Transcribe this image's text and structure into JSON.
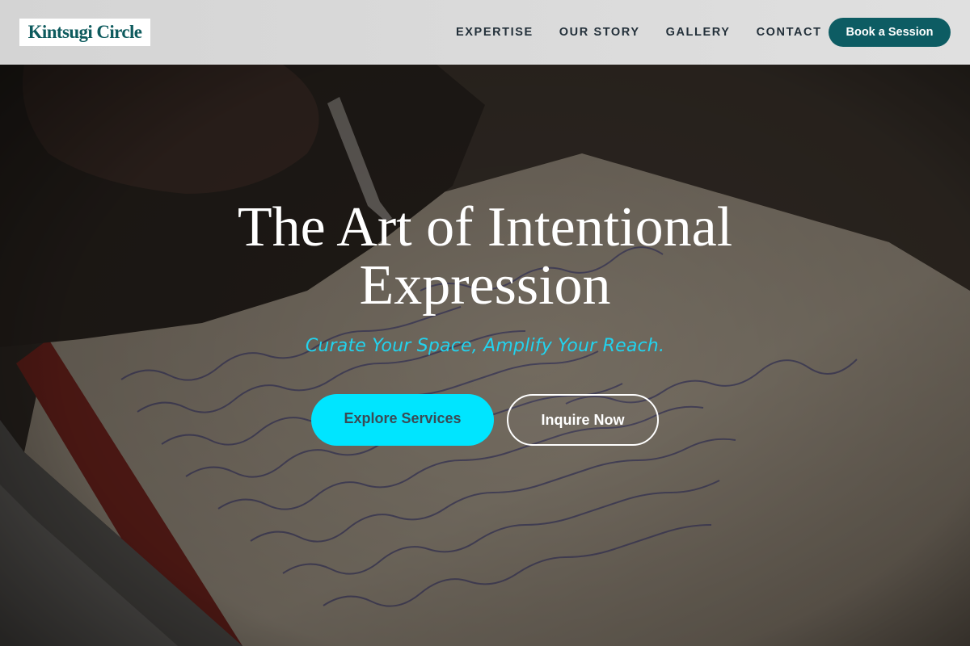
{
  "brand": {
    "name": "Kintsugi Circle"
  },
  "nav": {
    "items": [
      {
        "label": "EXPERTISE"
      },
      {
        "label": "OUR STORY"
      },
      {
        "label": "GALLERY"
      },
      {
        "label": "CONTACT"
      }
    ],
    "cta_label": "Book a Session"
  },
  "hero": {
    "title_line1": "The Art of Intentional",
    "title_line2": "Expression",
    "subtitle": "Curate Your Space, Amplify Your Reach.",
    "primary_button": "Explore Services",
    "secondary_button": "Inquire Now",
    "background_image": "handwritten-notebook-photo"
  },
  "colors": {
    "brand_teal": "#0d5c63",
    "accent_cyan": "#00e5ff",
    "subtitle_cyan": "#22d3ee",
    "header_bg": "#dadada"
  }
}
